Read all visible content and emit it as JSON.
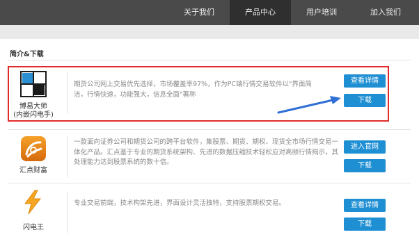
{
  "nav": {
    "items": [
      {
        "label": "关于我们",
        "active": false
      },
      {
        "label": "产品中心",
        "active": true
      },
      {
        "label": "用户培训",
        "active": false
      },
      {
        "label": "加入我们",
        "active": false
      }
    ]
  },
  "section": {
    "title": "简介&下载"
  },
  "products": [
    {
      "name_line1": "博易大师",
      "name_line2": "(内嵌闪电手)",
      "icon": "boyi-logo-icon",
      "description": "期货公司网上交易优先选择，市场覆盖率97%，作为PC端行情交易软件以\"界面简洁，行情快速，功能强大，信息全面\"著称",
      "buttons": [
        "查看详情",
        "下载"
      ]
    },
    {
      "name_line1": "汇点财富",
      "icon": "huidian-logo-icon",
      "description": "一款面向证券公司和期货公司的跨平台软件，集股票、期货、期权、现货全市场行情交易一体化产品。汇点基于专业的期货系统架构、先进的数据压缩技术轻松应对高频行情揭示，其处理能力达到股票系统的数十倍。",
      "buttons": [
        "进入官网",
        "下载"
      ]
    },
    {
      "name_line1": "闪电王",
      "icon": "lightning-logo-icon",
      "description": "专业交易前端，技术构架先进，界面设计灵活独特，支持股票期权交易。",
      "buttons": [
        "查看详情",
        "下载"
      ]
    }
  ],
  "colors": {
    "nav_bg": "#4a4a4a",
    "nav_active": "#2f2f2f",
    "button": "#1f8fd3",
    "highlight_border": "#e02b2b",
    "arrow": "#2f6fd6"
  }
}
